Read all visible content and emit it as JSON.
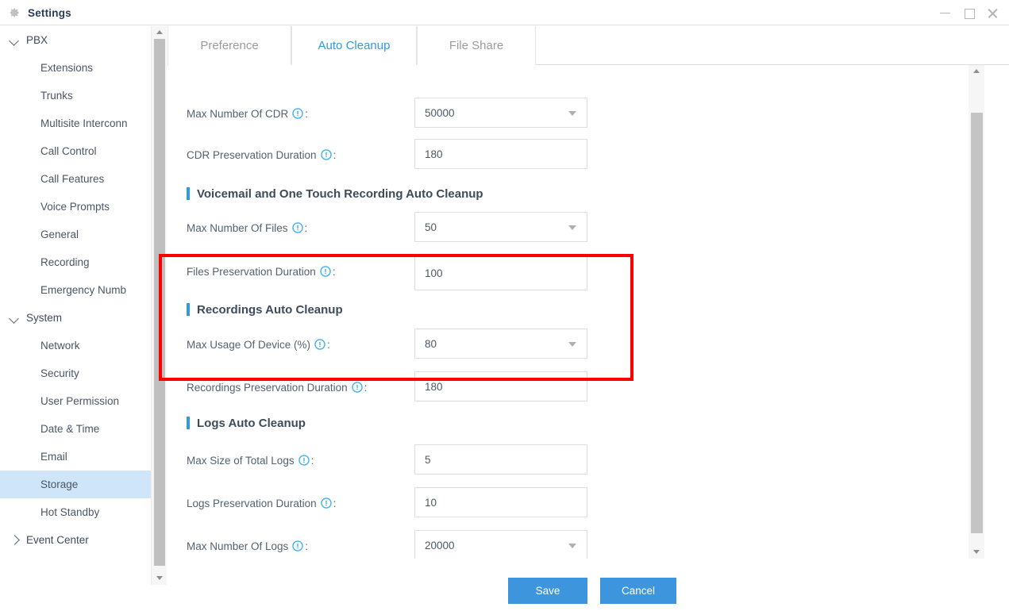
{
  "window": {
    "title": "Settings",
    "icon": "gear-icon",
    "controls": {
      "minimize": "minimize-icon",
      "maximize": "maximize-icon",
      "close": "close-icon"
    }
  },
  "sidebar": {
    "groups": [
      {
        "label": "PBX",
        "expanded": true,
        "items": [
          {
            "label": "Extensions",
            "selected": false
          },
          {
            "label": "Trunks",
            "selected": false
          },
          {
            "label": "Multisite Interconn",
            "selected": false
          },
          {
            "label": "Call Control",
            "selected": false
          },
          {
            "label": "Call Features",
            "selected": false
          },
          {
            "label": "Voice Prompts",
            "selected": false
          },
          {
            "label": "General",
            "selected": false
          },
          {
            "label": "Recording",
            "selected": false
          },
          {
            "label": "Emergency Numb",
            "selected": false
          }
        ]
      },
      {
        "label": "System",
        "expanded": true,
        "items": [
          {
            "label": "Network",
            "selected": false
          },
          {
            "label": "Security",
            "selected": false
          },
          {
            "label": "User Permission",
            "selected": false
          },
          {
            "label": "Date & Time",
            "selected": false
          },
          {
            "label": "Email",
            "selected": false
          },
          {
            "label": "Storage",
            "selected": true
          },
          {
            "label": "Hot Standby",
            "selected": false
          }
        ]
      },
      {
        "label": "Event Center",
        "expanded": false,
        "items": []
      }
    ]
  },
  "tabs": [
    {
      "label": "Preference",
      "active": false
    },
    {
      "label": "Auto Cleanup",
      "active": true
    },
    {
      "label": "File Share",
      "active": false
    }
  ],
  "form": {
    "fields": [
      {
        "label": "Max Number Of CDR",
        "value": "50000",
        "type": "select"
      },
      {
        "label": "CDR Preservation Duration",
        "value": "180",
        "type": "text"
      },
      {
        "label": "Max Number Of Files",
        "value": "50",
        "type": "select"
      },
      {
        "label": "Files Preservation Duration",
        "value": "100",
        "type": "text"
      },
      {
        "label": "Max Usage Of Device (%)",
        "value": "80",
        "type": "select"
      },
      {
        "label": "Recordings Preservation Duration",
        "value": "180",
        "type": "text"
      },
      {
        "label": "Max Size of Total Logs",
        "value": "5",
        "type": "text"
      },
      {
        "label": "Logs Preservation Duration",
        "value": "10",
        "type": "text"
      },
      {
        "label": "Max Number Of Logs",
        "value": "20000",
        "type": "select"
      }
    ],
    "sections": [
      {
        "title": "Voicemail and One Touch Recording Auto Cleanup"
      },
      {
        "title": "Recordings Auto Cleanup"
      },
      {
        "title": "Logs Auto Cleanup"
      }
    ]
  },
  "footer": {
    "save_label": "Save",
    "cancel_label": "Cancel"
  },
  "colors": {
    "accent": "#2f9ae0",
    "button": "#3d96dd",
    "selection": "#cfe6fa",
    "annotation": "#fc0000"
  }
}
